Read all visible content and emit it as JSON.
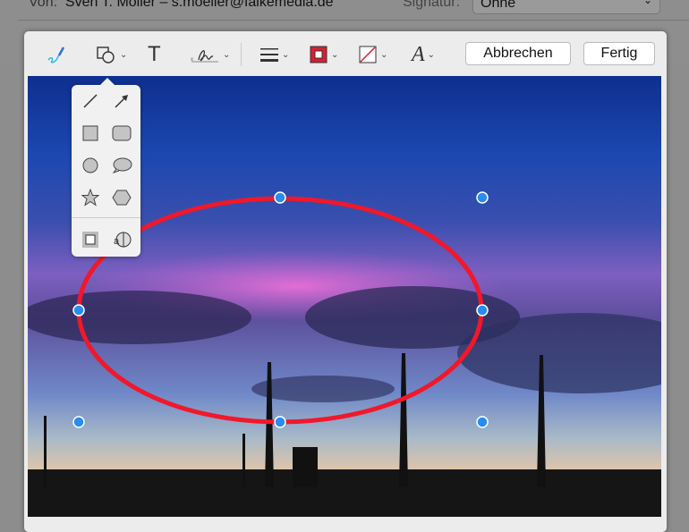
{
  "mail_header": {
    "from_label": "Von:",
    "from_value": "Sven T. Möller – s.moeller@falkemedia.de",
    "signature_label": "Signatur:",
    "signature_value": "Ohne"
  },
  "toolbar": {
    "tools": [
      "sketch-icon",
      "shapes-icon",
      "text-icon",
      "signature-icon",
      "line-style-icon",
      "border-color-icon",
      "fill-color-icon",
      "font-icon"
    ],
    "cancel_label": "Abbrechen",
    "done_label": "Fertig",
    "border_color": "#d42030"
  },
  "shapes_popover": {
    "items": [
      "line",
      "arrow",
      "rectangle",
      "rounded-rectangle",
      "oval",
      "speech-bubble",
      "star",
      "hexagon",
      "mask",
      "loupe"
    ]
  },
  "annotation": {
    "shape": "oval",
    "stroke_color": "#f0182a",
    "handle_color": "#2a8cf0"
  }
}
